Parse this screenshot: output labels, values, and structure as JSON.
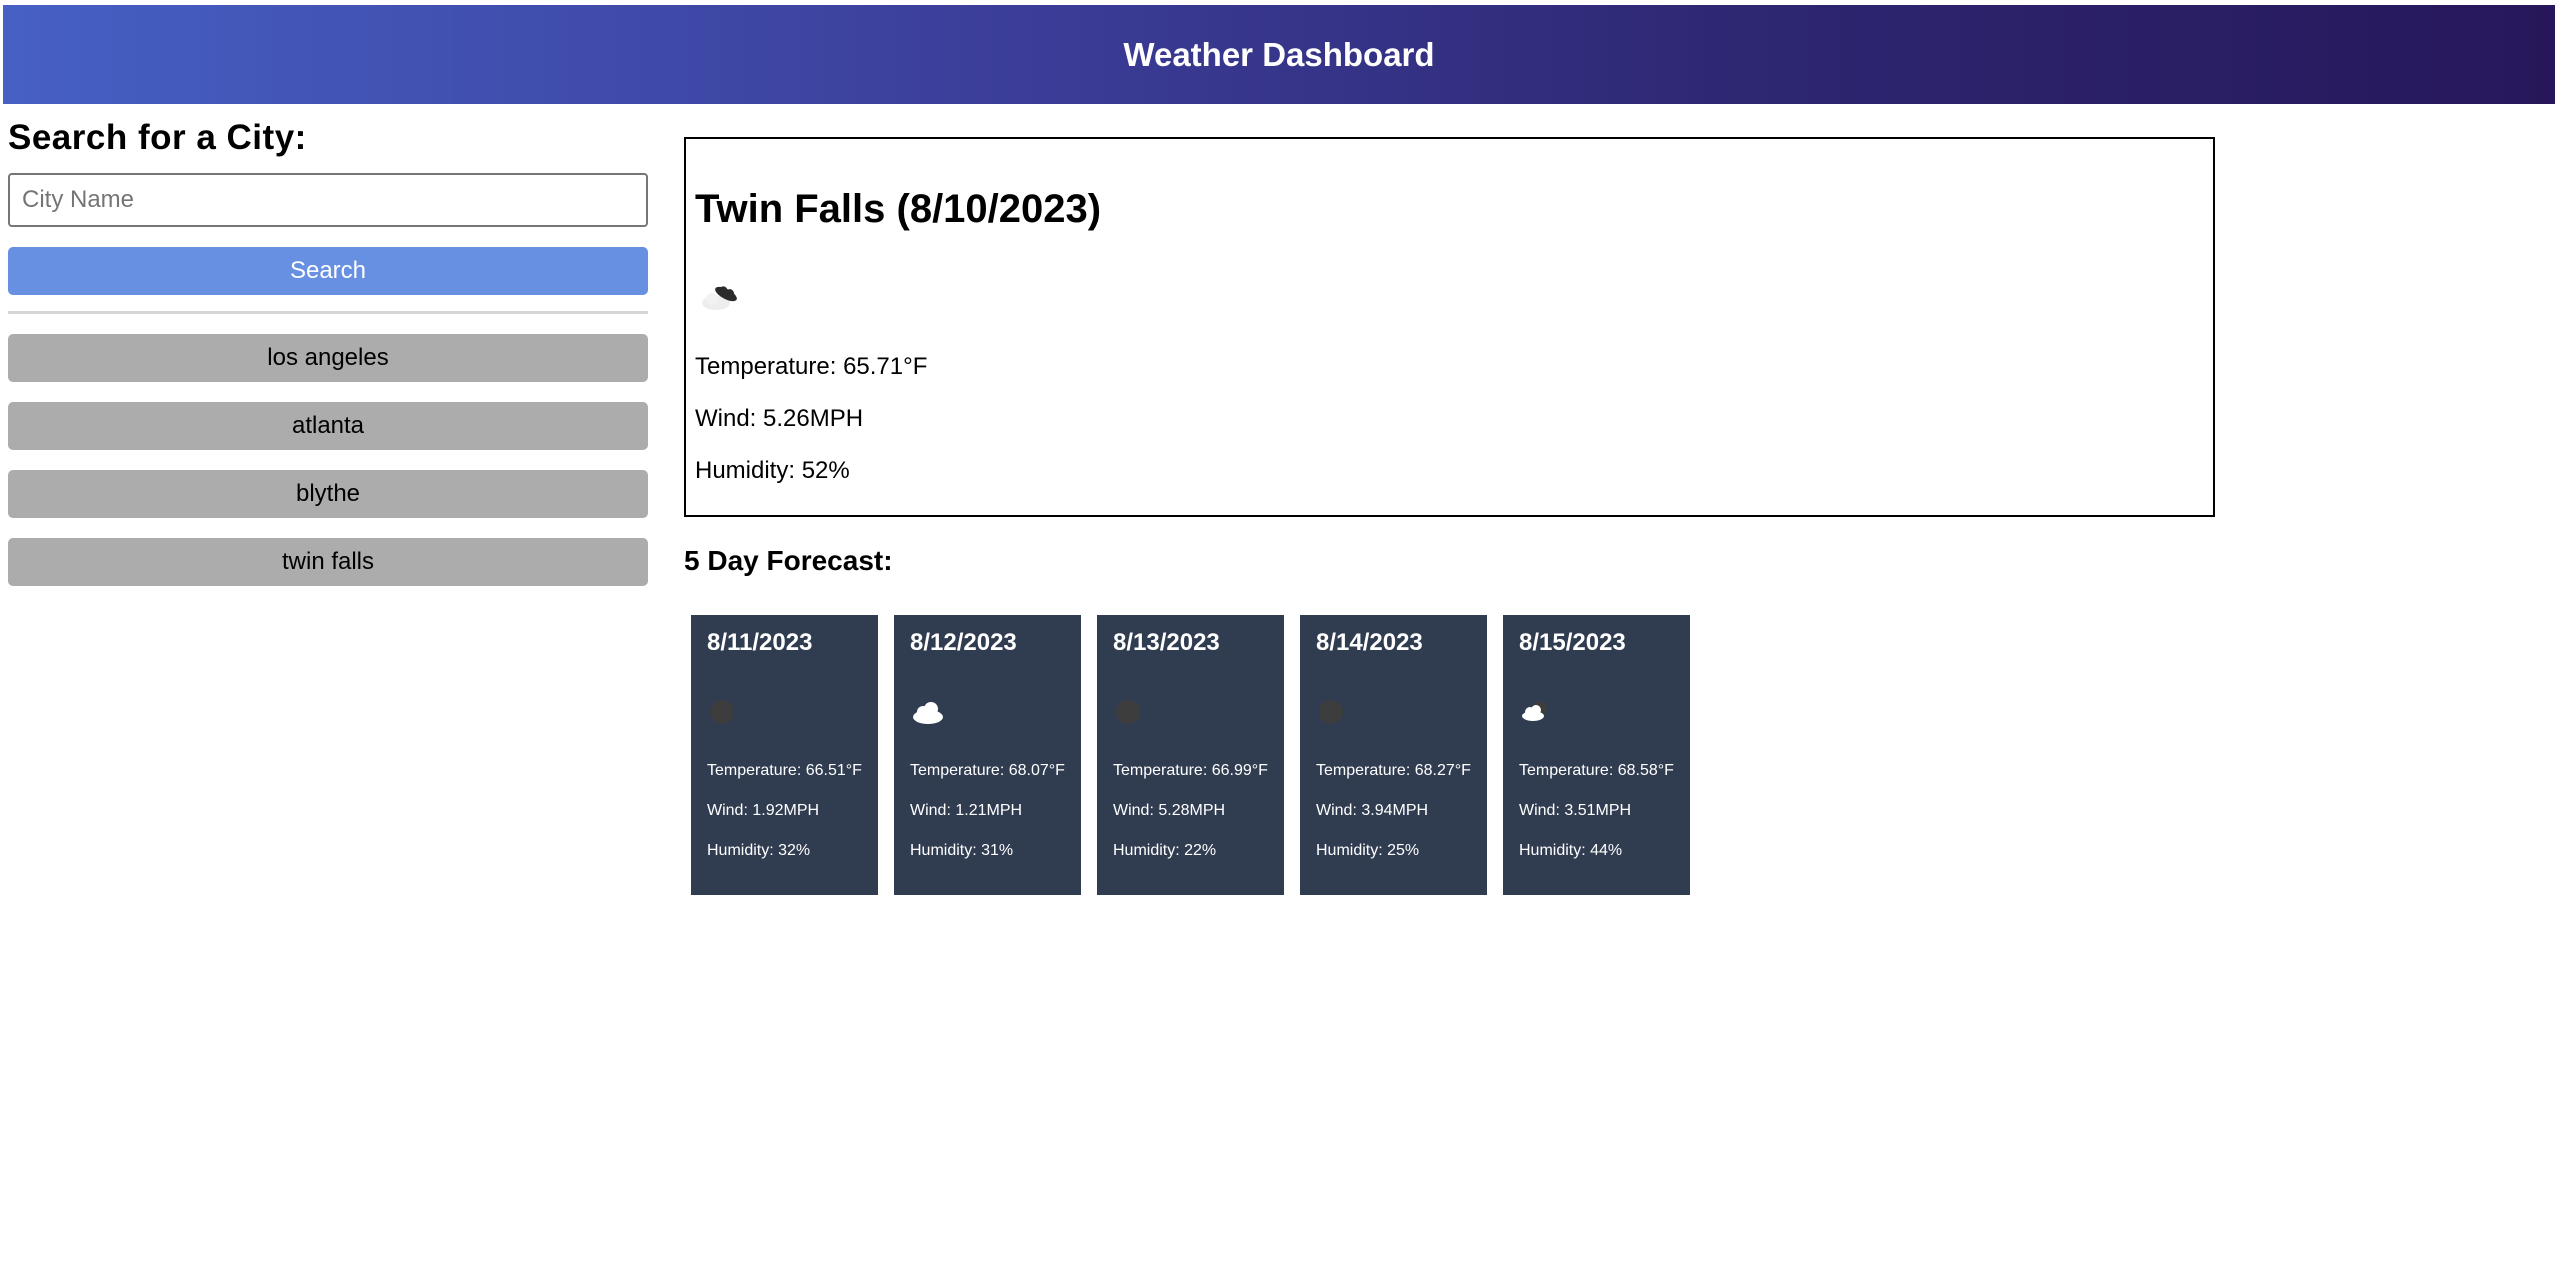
{
  "header": {
    "title": "Weather Dashboard"
  },
  "sidebar": {
    "heading": "Search for a City:",
    "input_placeholder": "City Name",
    "search_label": "Search",
    "history": [
      "los angeles",
      "atlanta",
      "blythe",
      "twin falls"
    ]
  },
  "current": {
    "title": "Twin Falls (8/10/2023)",
    "icon": "broken-clouds-icon",
    "temperature": "Temperature: 65.71°F",
    "wind": "Wind: 5.26MPH",
    "humidity": "Humidity: 52%"
  },
  "forecast": {
    "title": "5 Day Forecast:",
    "days": [
      {
        "date": "8/11/2023",
        "icon": "clear-night-icon",
        "temperature": "Temperature: 66.51°F",
        "wind": "Wind: 1.92MPH",
        "humidity": "Humidity: 32%"
      },
      {
        "date": "8/12/2023",
        "icon": "cloud-icon",
        "temperature": "Temperature: 68.07°F",
        "wind": "Wind: 1.21MPH",
        "humidity": "Humidity: 31%"
      },
      {
        "date": "8/13/2023",
        "icon": "clear-night-icon",
        "temperature": "Temperature: 66.99°F",
        "wind": "Wind: 5.28MPH",
        "humidity": "Humidity: 22%"
      },
      {
        "date": "8/14/2023",
        "icon": "clear-night-icon",
        "temperature": "Temperature: 68.27°F",
        "wind": "Wind: 3.94MPH",
        "humidity": "Humidity: 25%"
      },
      {
        "date": "8/15/2023",
        "icon": "partly-cloudy-night-icon",
        "temperature": "Temperature: 68.58°F",
        "wind": "Wind: 3.51MPH",
        "humidity": "Humidity: 44%"
      }
    ]
  }
}
